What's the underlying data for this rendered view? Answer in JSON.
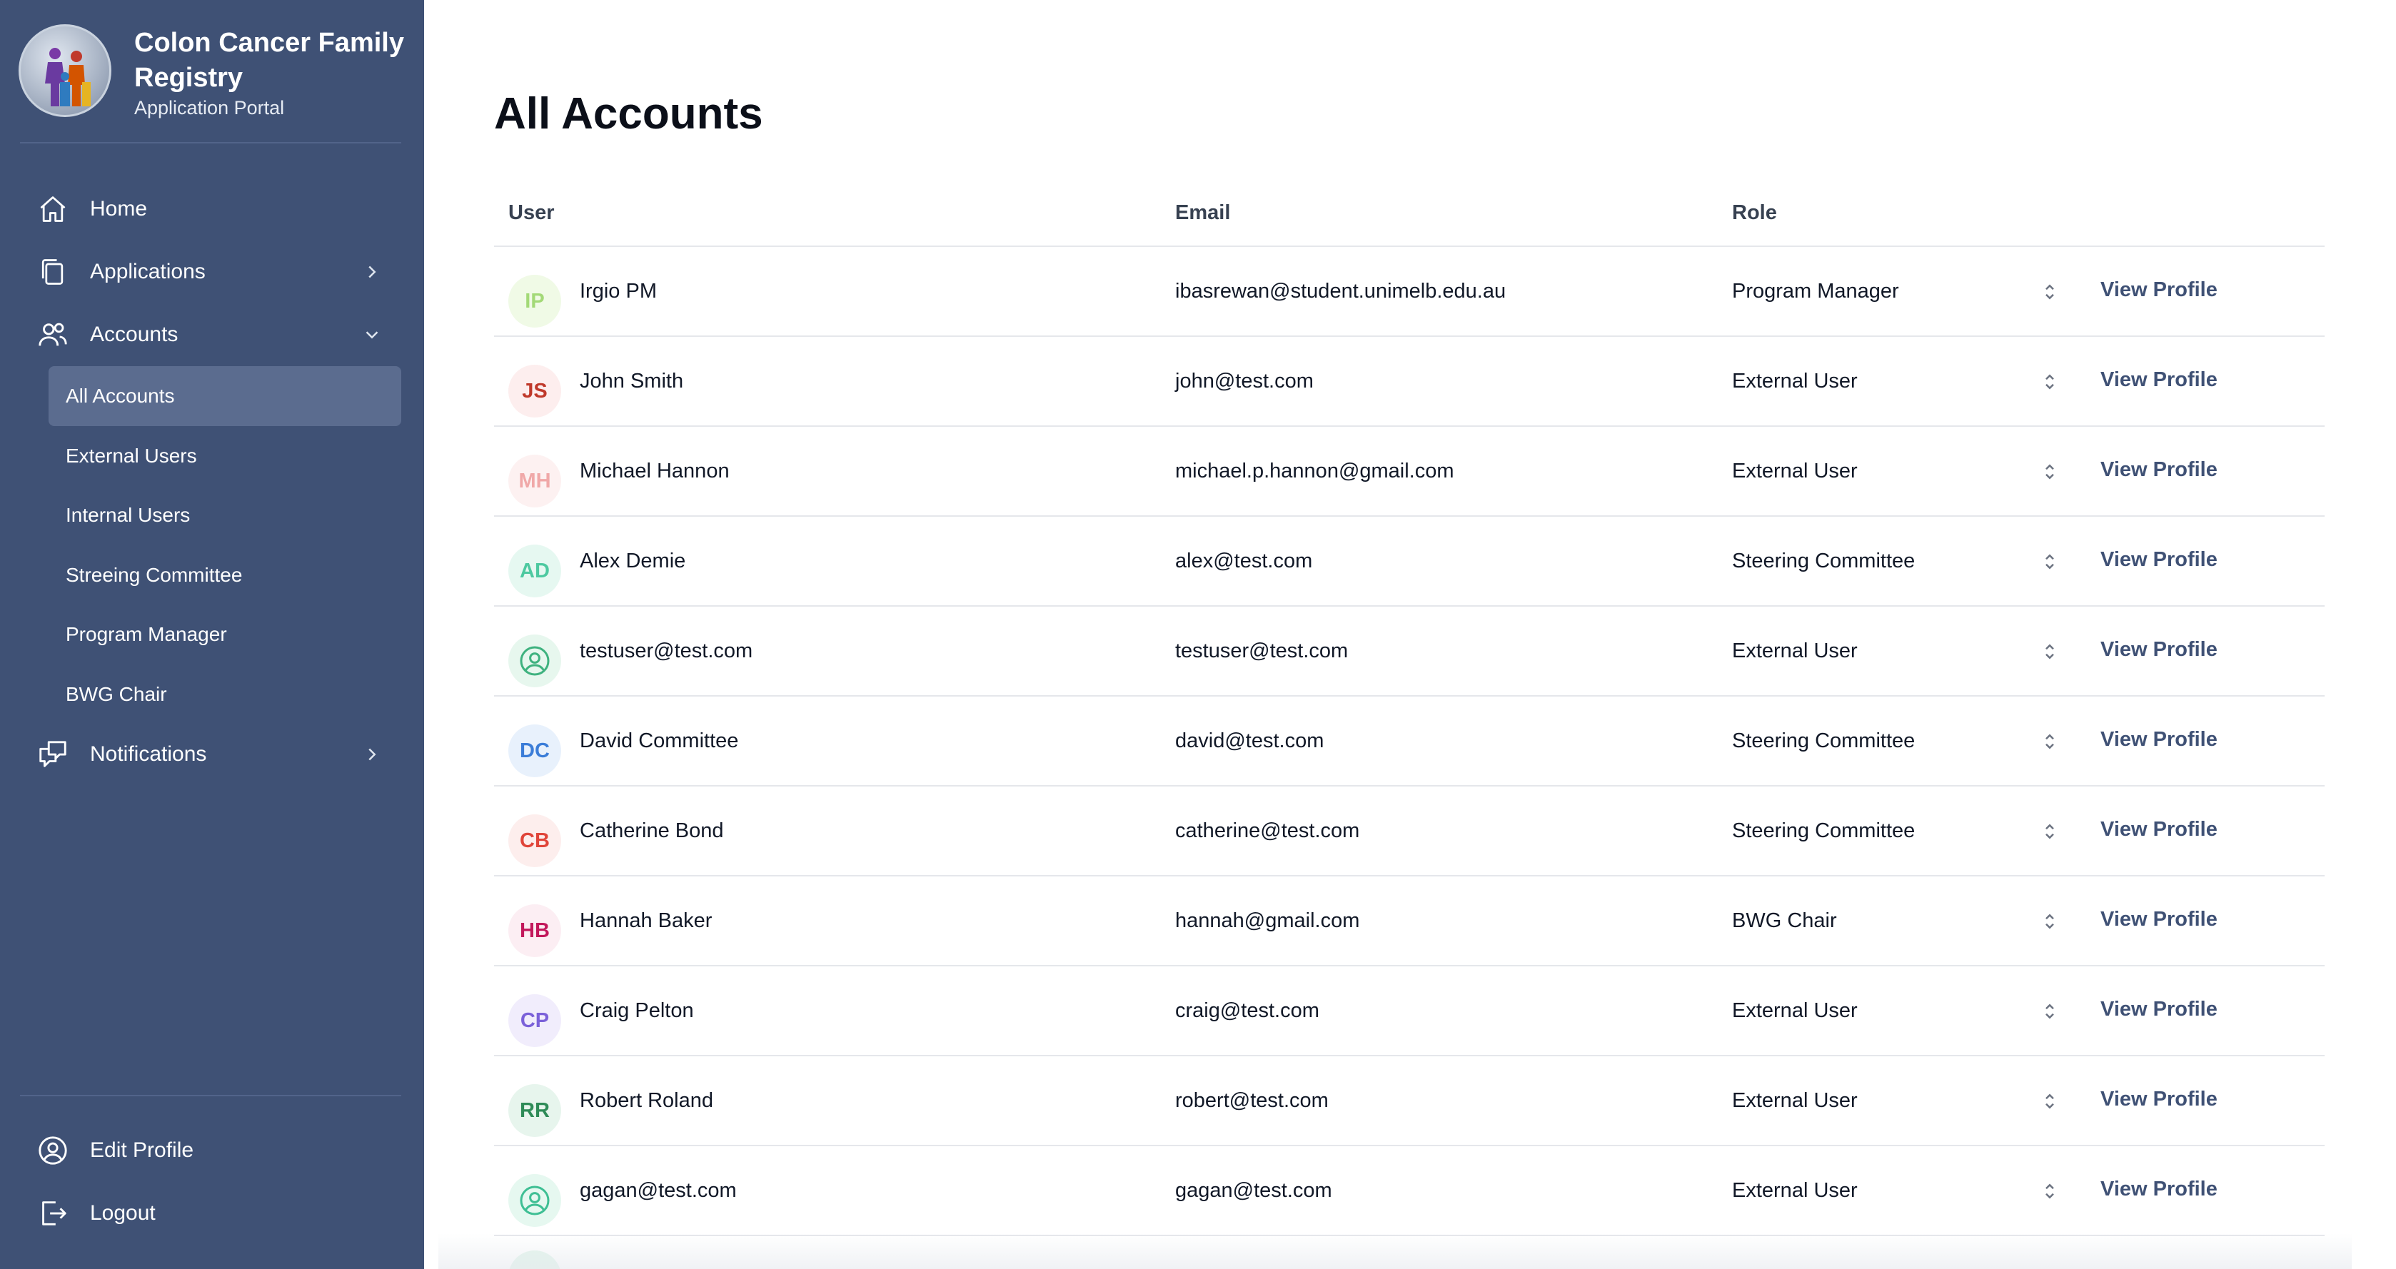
{
  "brand": {
    "title": "Colon Cancer Family Registry",
    "subtitle": "Application Portal"
  },
  "nav": {
    "home": "Home",
    "applications": "Applications",
    "accounts": "Accounts",
    "accounts_sub": [
      "All Accounts",
      "External Users",
      "Internal Users",
      "Streeing Committee",
      "Program Manager",
      "BWG Chair"
    ],
    "notifications": "Notifications",
    "edit_profile": "Edit Profile",
    "logout": "Logout"
  },
  "page": {
    "title": "All Accounts"
  },
  "table": {
    "headers": {
      "user": "User",
      "email": "Email",
      "role": "Role"
    },
    "view_label": "View Profile",
    "rows": [
      {
        "initials": "IP",
        "name": "Irgio PM",
        "email": "ibasrewan@student.unimelb.edu.au",
        "role": "Program Manager",
        "fg": "#a3d977",
        "bg": "#f0fae6"
      },
      {
        "initials": "JS",
        "name": "John Smith",
        "email": "john@test.com",
        "role": "External User",
        "fg": "#c0392b",
        "bg": "#fdeeee"
      },
      {
        "initials": "MH",
        "name": "Michael Hannon",
        "email": "michael.p.hannon@gmail.com",
        "role": "External User",
        "fg": "#f0a8a8",
        "bg": "#fdf1f1"
      },
      {
        "initials": "AD",
        "name": "Alex Demie",
        "email": "alex@test.com",
        "role": "Steering Committee",
        "fg": "#4dc9a0",
        "bg": "#e6f8f1"
      },
      {
        "initials": "",
        "name": "testuser@test.com",
        "email": "testuser@test.com",
        "role": "External User",
        "fg": "#3fb27f",
        "bg": "#e7f7ee",
        "icon": "user-circle-icon"
      },
      {
        "initials": "DC",
        "name": "David Committee",
        "email": "david@test.com",
        "role": "Steering Committee",
        "fg": "#3b7dd8",
        "bg": "#e8f1fc"
      },
      {
        "initials": "CB",
        "name": "Catherine Bond",
        "email": "catherine@test.com",
        "role": "Steering Committee",
        "fg": "#e0453a",
        "bg": "#fdeeed"
      },
      {
        "initials": "HB",
        "name": "Hannah Baker",
        "email": "hannah@gmail.com",
        "role": "BWG Chair",
        "fg": "#c2185b",
        "bg": "#fceef3"
      },
      {
        "initials": "CP",
        "name": "Craig Pelton",
        "email": "craig@test.com",
        "role": "External User",
        "fg": "#7b61d9",
        "bg": "#f1edfc"
      },
      {
        "initials": "RR",
        "name": "Robert Roland",
        "email": "robert@test.com",
        "role": "External User",
        "fg": "#2e8b57",
        "bg": "#e7f5ed"
      },
      {
        "initials": "",
        "name": "gagan@test.com",
        "email": "gagan@test.com",
        "role": "External User",
        "fg": "#3fbf94",
        "bg": "#e6f8f0",
        "icon": "user-circle-icon"
      }
    ]
  },
  "colors": {
    "sidebar": "#3f5175",
    "active_item": "#5b6c8f",
    "link": "#3f5175"
  }
}
